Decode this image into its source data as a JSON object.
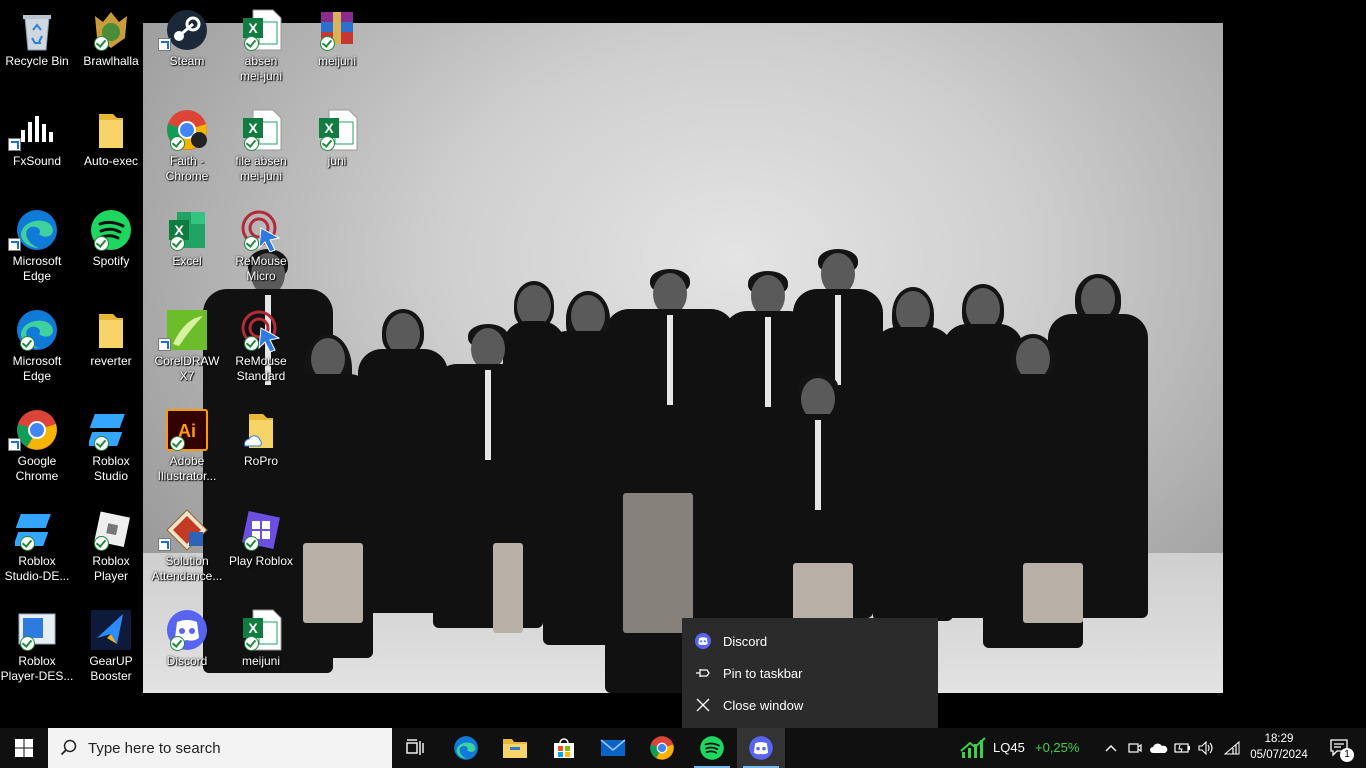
{
  "desktop": {
    "icons": [
      {
        "label": "Recycle Bin",
        "icon": "recycle-bin-icon"
      },
      {
        "label": "FxSound",
        "icon": "fxsound-icon"
      },
      {
        "label": "Microsoft\nEdge",
        "icon": "edge-icon"
      },
      {
        "label": "Microsoft\nEdge",
        "icon": "edge-icon"
      },
      {
        "label": "Google\nChrome",
        "icon": "chrome-icon"
      },
      {
        "label": "Roblox\nStudio-DE...",
        "icon": "roblox-studio-icon"
      },
      {
        "label": "Roblox\nPlayer-DES...",
        "icon": "roblox-player-icon"
      },
      {
        "label": "Brawlhalla",
        "icon": "brawlhalla-icon"
      },
      {
        "label": "Auto-exec",
        "icon": "folder-icon"
      },
      {
        "label": "Spotify",
        "icon": "spotify-icon"
      },
      {
        "label": "reverter",
        "icon": "folder-icon"
      },
      {
        "label": "Roblox\nStudio",
        "icon": "roblox-studio-icon"
      },
      {
        "label": "Roblox\nPlayer",
        "icon": "roblox-player-icon"
      },
      {
        "label": "GearUP\nBooster",
        "icon": "gearup-icon"
      },
      {
        "label": "Steam",
        "icon": "steam-icon"
      },
      {
        "label": "Faith -\nChrome",
        "icon": "chrome-icon"
      },
      {
        "label": "Excel",
        "icon": "excel-icon"
      },
      {
        "label": "CorelDRAW\nX7",
        "icon": "coreldraw-icon"
      },
      {
        "label": "Adobe\nIllustrator...",
        "icon": "illustrator-icon"
      },
      {
        "label": "Solution\nAttendance...",
        "icon": "solution-attendance-icon"
      },
      {
        "label": "Discord",
        "icon": "discord-icon"
      },
      {
        "label": "absen\nmei-juni",
        "icon": "excel-file-icon"
      },
      {
        "label": "file absen\nmei-juni",
        "icon": "excel-file-icon"
      },
      {
        "label": "ReMouse\nMicro",
        "icon": "remouse-icon"
      },
      {
        "label": "ReMouse\nStandard",
        "icon": "remouse-icon"
      },
      {
        "label": "RoPro",
        "icon": "folder-icon"
      },
      {
        "label": "Play Roblox",
        "icon": "roblox-icon"
      },
      {
        "label": "meijuni",
        "icon": "excel-file-icon"
      },
      {
        "label": "meijuni",
        "icon": "winrar-icon"
      },
      {
        "label": "juni",
        "icon": "excel-file-icon"
      }
    ]
  },
  "jumplist": {
    "app_label": "Discord",
    "pin_label": "Pin to taskbar",
    "close_label": "Close window"
  },
  "taskbar": {
    "search_placeholder": "Type here to search",
    "ticker_name": "LQ45",
    "ticker_change": "+0,25%",
    "time": "18:29",
    "date": "05/07/2024",
    "notification_count": "1",
    "colors": {
      "accent": "#76b9ed",
      "ticker_up": "#3fcf4a",
      "search_bg": "#f3f3f3"
    }
  }
}
